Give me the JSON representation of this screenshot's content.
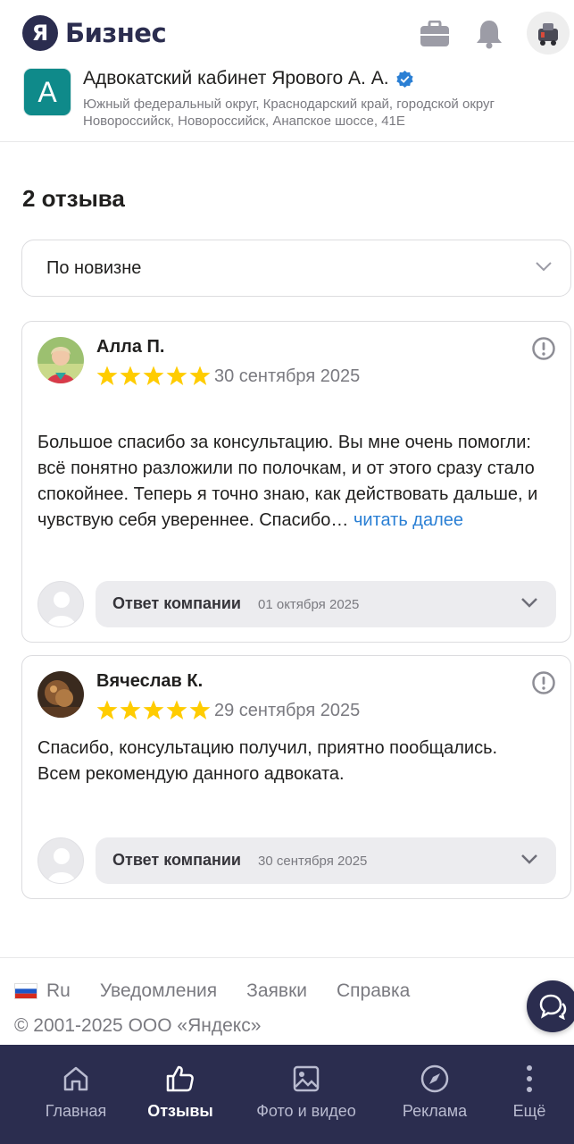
{
  "header": {
    "logo_letter": "Я",
    "logo_text": "Бизнес",
    "icons": [
      "briefcase-icon",
      "bell-icon",
      "user-avatar"
    ]
  },
  "company": {
    "badge_letter": "А",
    "name": "Адвокатский кабинет Ярового А. А.",
    "verified": true,
    "address": "Южный федеральный округ, Краснодарский край, городской округ Новороссийск, Новороссийск, Анапское шоссе, 41Е"
  },
  "reviews_section": {
    "title": "2 отзыва",
    "sort": {
      "selected": "По новизне"
    }
  },
  "reviews": [
    {
      "author": "Алла П.",
      "rating": 5,
      "date": "30 сентября 2025",
      "text": "Большое спасибо за консультацию. Вы мне очень помогли: всё понятно разложили по полочкам, и от этого сразу стало спокойнее. Теперь я точно знаю, как действовать дальше, и чувствую себя увереннее. Спасибо…",
      "read_more": "читать далее",
      "reply": {
        "label": "Ответ компании",
        "date": "01 октября 2025"
      }
    },
    {
      "author": "Вячеслав К.",
      "rating": 5,
      "date": "29 сентября 2025",
      "text_lines": [
        "Спасибо, консультацию получил, приятно пообщались.",
        "Всем рекомендую данного адвоката."
      ],
      "reply": {
        "label": "Ответ компании",
        "date": "30 сентября 2025"
      }
    }
  ],
  "footer": {
    "language": "Ru",
    "links": [
      "Уведомления",
      "Заявки",
      "Справка"
    ],
    "copyright": "© 2001-2025  ООО «Яндекс»"
  },
  "bottom_nav": [
    {
      "label": "Главная",
      "icon": "home-icon",
      "active": false
    },
    {
      "label": "Отзывы",
      "icon": "thumbs-up-icon",
      "active": true
    },
    {
      "label": "Фото и видео",
      "icon": "image-icon",
      "active": false
    },
    {
      "label": "Реклама",
      "icon": "ad-compass-icon",
      "active": false
    },
    {
      "label": "Ещё",
      "icon": "more-vertical-icon",
      "active": false
    }
  ],
  "colors": {
    "brand_dark": "#2b2d4f",
    "star": "#ffcc00",
    "link": "#2a7fd4",
    "company_badge": "#0f8a8a"
  }
}
